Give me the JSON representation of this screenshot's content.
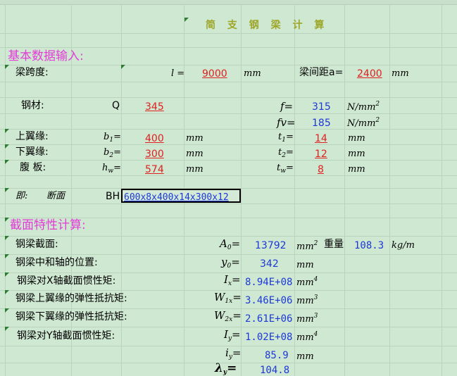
{
  "title": "简 支 钢 梁 计 算",
  "section_basic": "基本数据输入:",
  "span": {
    "label": "梁跨度:",
    "sym": "l =",
    "value": "9000",
    "unit": "mm"
  },
  "spacing": {
    "label": "梁间距a=",
    "value": "2400",
    "unit": "mm"
  },
  "steel": {
    "label": "钢材:",
    "grade_sym": "Q",
    "grade": "345",
    "f_sym": "f=",
    "f_value": "315",
    "f_unit": "N/mm",
    "f_unit_sup": "2",
    "fv_sym": "fv=",
    "fv_value": "185",
    "fv_unit": "N/mm",
    "fv_unit_sup": "2"
  },
  "top_flange": {
    "label": "上翼缘:",
    "b_sym": "b",
    "b_sub": "1",
    "b_value": "400",
    "b_unit": "mm",
    "t_sym": "t",
    "t_sub": "1",
    "t_value": "14",
    "t_unit": "mm"
  },
  "bottom_flange": {
    "label": "下翼缘:",
    "b_sym": "b",
    "b_sub": "2",
    "b_value": "300",
    "b_unit": "mm",
    "t_sym": "t",
    "t_sub": "2",
    "t_value": "12",
    "t_unit": "mm"
  },
  "web": {
    "label": "腹  板:",
    "h_sym": "h",
    "h_sub": "w",
    "h_value": "574",
    "h_unit": "mm",
    "t_sym": "t",
    "t_sub": "w",
    "t_value": "8",
    "t_unit": "mm"
  },
  "section_row": {
    "label1": "即:",
    "label2": "断面",
    "type": "BH",
    "value": "600x8x400x14x300x12"
  },
  "section_props": "截面特性计算:",
  "props": [
    {
      "label": "钢梁截面:",
      "sym": "A",
      "sub": "0",
      "value": "13792",
      "unit": "mm",
      "unit_sup": "2"
    },
    {
      "label": "钢梁中和轴的位置:",
      "sym": "y",
      "sub": "0",
      "value": "342",
      "unit": "mm",
      "unit_sup": ""
    },
    {
      "label": "钢梁对X轴截面惯性矩:",
      "sym": "I",
      "sub": "x",
      "value": "8.94E+08",
      "unit": "mm",
      "unit_sup": "4"
    },
    {
      "label": "钢梁上翼缘的弹性抵抗矩:",
      "sym": "W",
      "sub": "1x",
      "value": "3.46E+06",
      "unit": "mm",
      "unit_sup": "3"
    },
    {
      "label": "钢梁下翼缘的弹性抵抗矩:",
      "sym": "W",
      "sub": "2x",
      "value": "2.61E+06",
      "unit": "mm",
      "unit_sup": "3"
    },
    {
      "label": "钢梁对Y轴截面惯性矩:",
      "sym": "I",
      "sub": "y",
      "value": "1.02E+08",
      "unit": "mm",
      "unit_sup": "4"
    },
    {
      "label": "",
      "sym": "i",
      "sub": "y",
      "value": "85.9",
      "unit": "mm",
      "unit_sup": ""
    },
    {
      "label": "",
      "sym": "λ",
      "sub": "y",
      "value": "104.8",
      "unit": "",
      "unit_sup": ""
    }
  ],
  "weight": {
    "label": "重量",
    "value": "108.3",
    "unit": "kg/m"
  }
}
